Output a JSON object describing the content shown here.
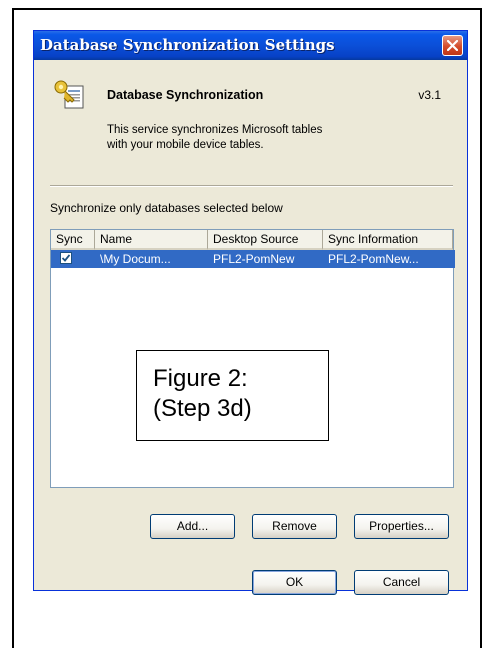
{
  "window": {
    "title": "Database Synchronization Settings",
    "close_icon": "close-icon"
  },
  "header": {
    "app_icon": "database-sync-icon",
    "app_name": "Database Synchronization",
    "version": "v3.1",
    "description_line1": "This service synchronizes Microsoft tables",
    "description_line2": "with your mobile device tables."
  },
  "list": {
    "label": "Synchronize only databases selected below",
    "columns": [
      "Sync",
      "Name",
      "Desktop Source",
      "Sync Information"
    ],
    "rows": [
      {
        "checked": true,
        "name": "\\My Docum...",
        "desktop_source": "PFL2-PomNew",
        "sync_information": "PFL2-PomNew..."
      }
    ]
  },
  "figure_note": {
    "line1": "Figure 2:",
    "line2": "(Step 3d)"
  },
  "buttons": {
    "add": "Add...",
    "remove": "Remove",
    "properties": "Properties...",
    "ok": "OK",
    "cancel": "Cancel"
  },
  "colors": {
    "titlebar": "#0a58e8",
    "selection": "#316ac5",
    "dialog_bg": "#ece9d8",
    "close_button": "#d44c2b"
  }
}
